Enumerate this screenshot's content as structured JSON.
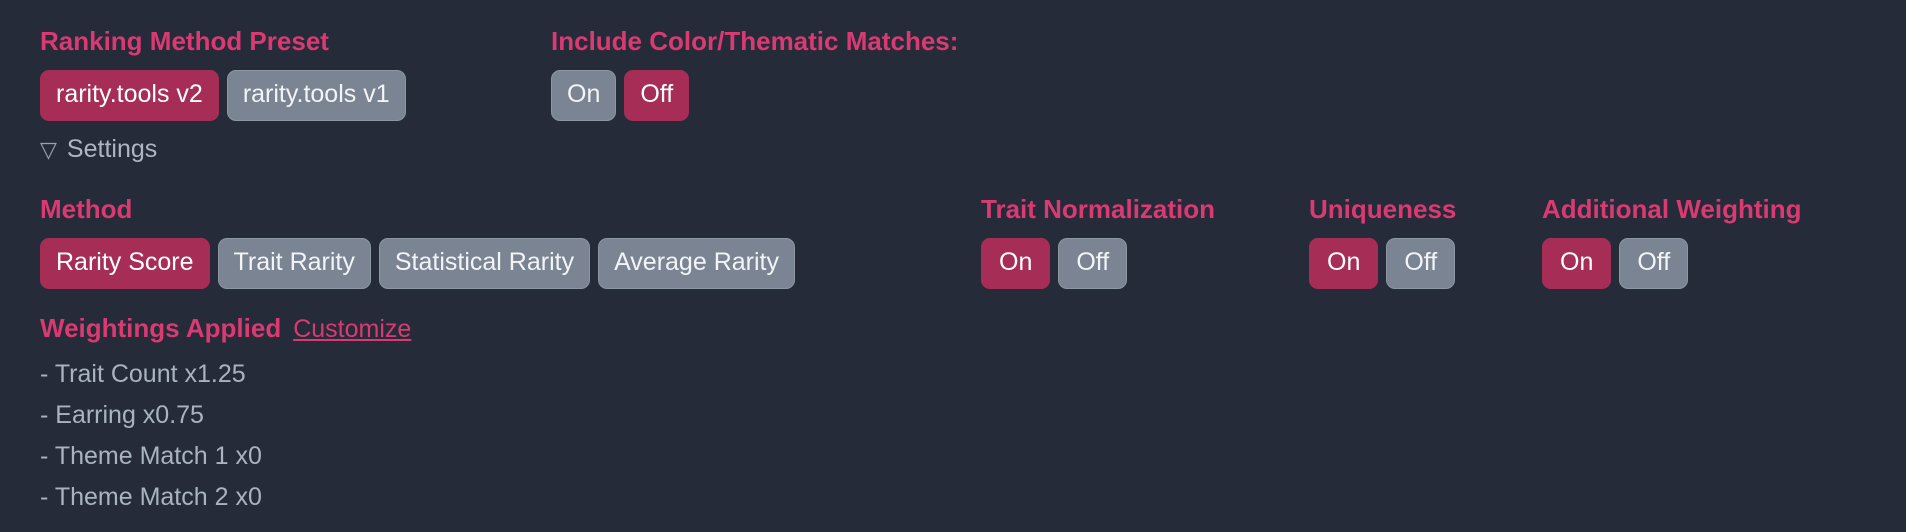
{
  "colors": {
    "background": "#252b39",
    "accent_pink": "#d93a72",
    "pill_active": "#a62e56",
    "pill_inactive": "#7b8492",
    "muted_text": "#aab3c0"
  },
  "preset": {
    "heading": "Ranking Method Preset",
    "options": [
      {
        "label": "rarity.tools v2",
        "state": "active"
      },
      {
        "label": "rarity.tools v1",
        "state": "inactive"
      }
    ]
  },
  "thematic": {
    "heading": "Include Color/Thematic Matches:",
    "options": [
      {
        "label": "On",
        "state": "inactive"
      },
      {
        "label": "Off",
        "state": "active"
      }
    ]
  },
  "settings": {
    "icon": "triangle-down-icon",
    "glyph": "▽",
    "label": "Settings"
  },
  "method": {
    "heading": "Method",
    "options": [
      {
        "label": "Rarity Score",
        "state": "active"
      },
      {
        "label": "Trait Rarity",
        "state": "inactive"
      },
      {
        "label": "Statistical Rarity",
        "state": "inactive"
      },
      {
        "label": "Average Rarity",
        "state": "inactive"
      }
    ]
  },
  "trait_normalization": {
    "heading": "Trait Normalization",
    "options": [
      {
        "label": "On",
        "state": "active"
      },
      {
        "label": "Off",
        "state": "inactive"
      }
    ]
  },
  "uniqueness": {
    "heading": "Uniqueness",
    "options": [
      {
        "label": "On",
        "state": "active"
      },
      {
        "label": "Off",
        "state": "inactive"
      }
    ]
  },
  "additional_weighting": {
    "heading": "Additional Weighting",
    "options": [
      {
        "label": "On",
        "state": "active"
      },
      {
        "label": "Off",
        "state": "inactive"
      }
    ]
  },
  "weightings": {
    "title": "Weightings Applied",
    "customize_label": "Customize",
    "items": [
      "- Trait Count x1.25",
      "- Earring x0.75",
      "- Theme Match 1 x0",
      "- Theme Match 2 x0"
    ]
  }
}
